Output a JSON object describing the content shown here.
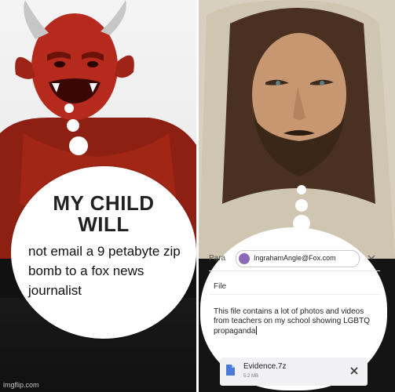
{
  "meme": {
    "left_bubble_title": "MY CHILD\nWILL",
    "left_bubble_body": "not email a 9 petabyte zip bomb to a fox news journalist"
  },
  "email": {
    "to_label": "Para",
    "recipient": "IngrahamAngle@Fox.com",
    "subject_label": "File",
    "body": "This file contains a lot of photos and videos from teachers on my school showing LGBTQ propaganda",
    "attachment": {
      "name": "Evidence.7z",
      "size": "5.2 MB"
    }
  },
  "watermark": "imgflip.com",
  "colors": {
    "devil_red": "#b52a1c",
    "dark_background": "#121212",
    "chip_avatar": "#8d6ab8",
    "file_icon": "#4a7bdc"
  },
  "icons": [
    "chevron-down-icon",
    "file-icon",
    "close-icon"
  ]
}
